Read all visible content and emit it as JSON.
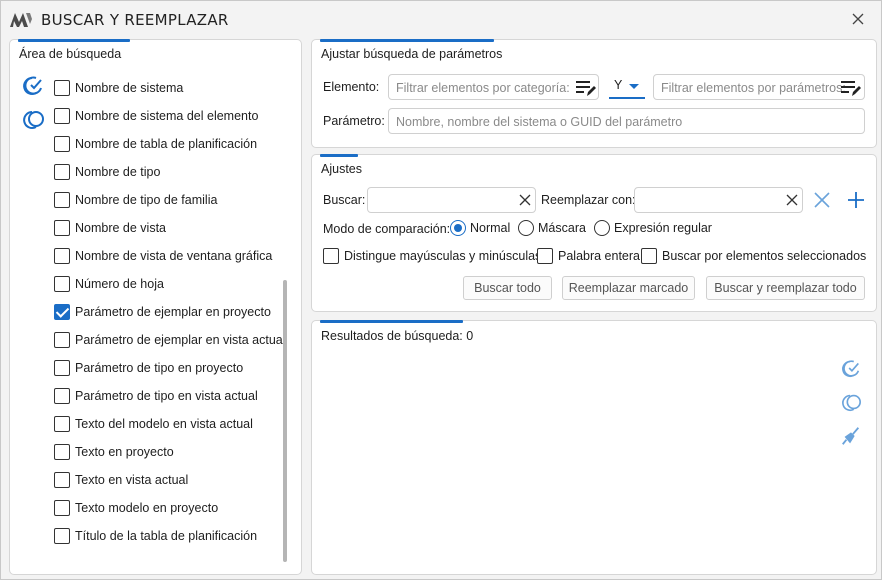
{
  "window": {
    "title": "BUSCAR Y REEMPLAZAR"
  },
  "search_area": {
    "title": "Área de búsqueda",
    "items": [
      {
        "label": "Nombre de sistema",
        "checked": false
      },
      {
        "label": "Nombre de sistema del elemento",
        "checked": false
      },
      {
        "label": "Nombre de tabla de planificación",
        "checked": false
      },
      {
        "label": "Nombre de tipo",
        "checked": false
      },
      {
        "label": "Nombre de tipo de familia",
        "checked": false
      },
      {
        "label": "Nombre de vista",
        "checked": false
      },
      {
        "label": "Nombre de vista de ventana gráfica",
        "checked": false
      },
      {
        "label": "Número de hoja",
        "checked": false
      },
      {
        "label": "Parámetro de ejemplar en proyecto",
        "checked": true
      },
      {
        "label": "Parámetro de ejemplar en vista actual",
        "checked": false
      },
      {
        "label": "Parámetro de tipo en proyecto",
        "checked": false
      },
      {
        "label": "Parámetro de tipo en vista actual",
        "checked": false
      },
      {
        "label": "Texto del modelo en vista actual",
        "checked": false
      },
      {
        "label": "Texto en proyecto",
        "checked": false
      },
      {
        "label": "Texto en vista actual",
        "checked": false
      },
      {
        "label": "Texto modelo en proyecto",
        "checked": false
      },
      {
        "label": "Título de la tabla de planificación",
        "checked": false
      }
    ]
  },
  "params": {
    "title": "Ajustar búsqueda de parámetros",
    "element_label": "Elemento:",
    "category_placeholder": "Filtrar elementos por categoría:",
    "logic_value": "Y",
    "param_filter_placeholder": "Filtrar elementos por parámetros:",
    "parameter_label": "Parámetro:",
    "parameter_placeholder": "Nombre, nombre del sistema o GUID del parámetro"
  },
  "settings": {
    "title": "Ajustes",
    "find_label": "Buscar:",
    "find_value": "",
    "replace_label": "Reemplazar con:",
    "replace_value": "",
    "compare_mode_label": "Modo de comparación:",
    "modes": [
      {
        "label": "Normal",
        "selected": true
      },
      {
        "label": "Máscara",
        "selected": false
      },
      {
        "label": "Expresión regular",
        "selected": false
      }
    ],
    "options": [
      {
        "label": "Distingue mayúsculas y minúsculas",
        "checked": false
      },
      {
        "label": "Palabra entera",
        "checked": false
      },
      {
        "label": "Buscar por elementos seleccionados",
        "checked": false
      }
    ],
    "buttons": {
      "find_all": "Buscar todo",
      "replace_marked": "Reemplazar marcado",
      "find_replace_all": "Buscar y reemplazar todo"
    }
  },
  "results": {
    "label": "Resultados de búsqueda: 0"
  },
  "colors": {
    "accent": "#1a6dc6",
    "icon_light": "#6aa3db"
  }
}
